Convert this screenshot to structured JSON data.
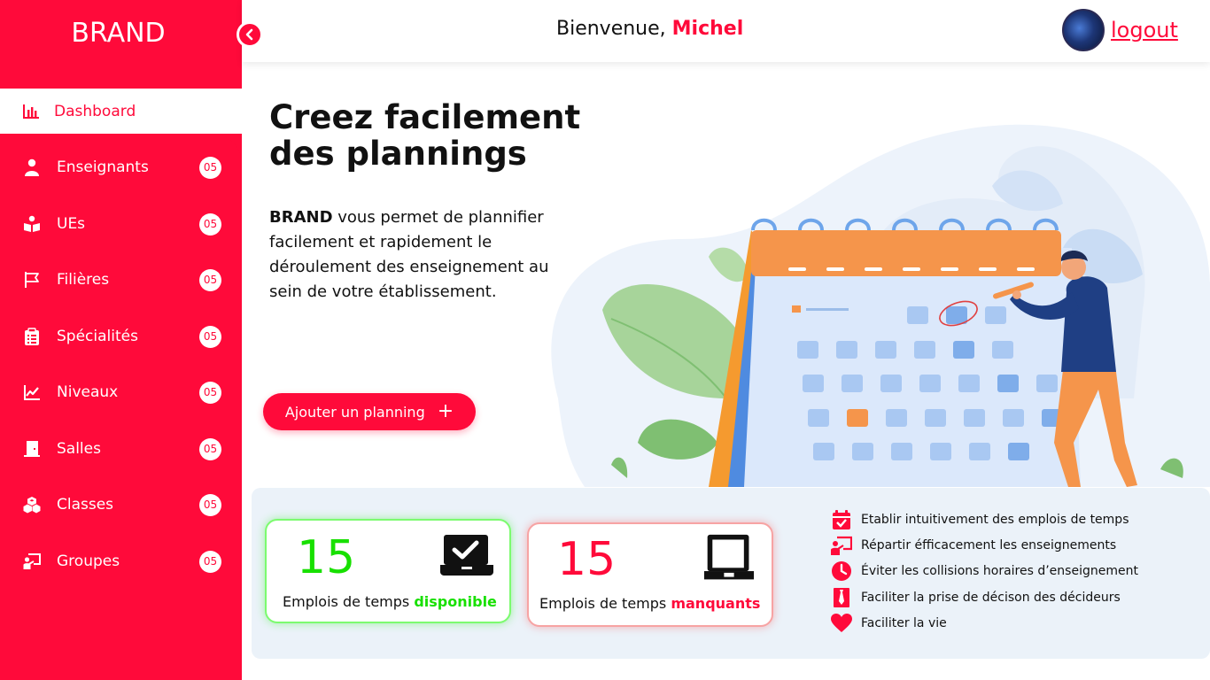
{
  "brand": "BRAND",
  "header": {
    "welcome_prefix": "Bienvenue,",
    "user_name": "Michel",
    "logout_label": "logout"
  },
  "sidebar": {
    "active": {
      "label": "Dashboard",
      "icon": "bar-chart-icon"
    },
    "items": [
      {
        "label": "Enseignants",
        "badge": "05",
        "icon": "user-icon"
      },
      {
        "label": "UEs",
        "badge": "05",
        "icon": "book-icon"
      },
      {
        "label": "Filières",
        "badge": "05",
        "icon": "flag-icon"
      },
      {
        "label": "Spécialités",
        "badge": "05",
        "icon": "clipboard-icon"
      },
      {
        "label": "Niveaux",
        "badge": "05",
        "icon": "trend-chart-icon"
      },
      {
        "label": "Salles",
        "badge": "05",
        "icon": "door-icon"
      },
      {
        "label": "Classes",
        "badge": "05",
        "icon": "cubes-icon"
      },
      {
        "label": "Groupes",
        "badge": "05",
        "icon": "presentation-icon"
      }
    ]
  },
  "hero": {
    "title": "Creez facilement des plannings",
    "text_brand": "BRAND",
    "text_rest": " vous permet de plannifier facilement et rapidement le déroulement des enseignement au sein de votre établissement.",
    "button_label": "Ajouter un planning",
    "button_icon": "plus-icon"
  },
  "cards": {
    "available": {
      "value": "15",
      "caption_prefix": "Emplois de temps ",
      "caption_highlight": "disponible",
      "icon": "laptop-check-icon",
      "color": "#18e000"
    },
    "missing": {
      "value": "15",
      "caption_prefix": "Emplois de temps ",
      "caption_highlight": "manquants",
      "icon": "monitor-icon",
      "color": "#ff0a3a"
    }
  },
  "features": [
    {
      "text": "Etablir intuitivement des emplois de temps",
      "icon": "calendar-check-icon"
    },
    {
      "text": "Répartir éfficacement les enseignements",
      "icon": "teacher-board-icon"
    },
    {
      "text": "Éviter les collisions horaires d’enseignement",
      "icon": "clock-icon"
    },
    {
      "text": "Faciliter la prise de décison des décideurs",
      "icon": "tie-icon"
    },
    {
      "text": "Faciliter la vie",
      "icon": "heart-icon"
    }
  ],
  "colors": {
    "accent": "#ff0a3a",
    "success": "#18e000",
    "panel": "#ebf2f9"
  }
}
